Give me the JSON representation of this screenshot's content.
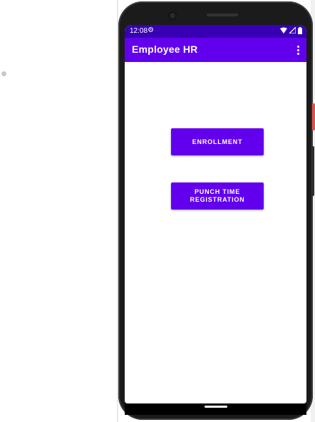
{
  "status_bar": {
    "time": "12:08",
    "settings_icon": "gear-icon",
    "icons": [
      "wifi-icon",
      "signal-icon",
      "battery-icon"
    ]
  },
  "app_bar": {
    "title": "Employee HR",
    "overflow_icon": "more-vert-icon"
  },
  "buttons": {
    "enrollment": "ENROLLMENT",
    "punch_time_line1": "PUNCH TIME",
    "punch_time_line2": "REGISTRATION"
  },
  "colors": {
    "primary": "#6200ee",
    "primary_dark": "#3700b3",
    "on_primary": "#ffffff"
  }
}
